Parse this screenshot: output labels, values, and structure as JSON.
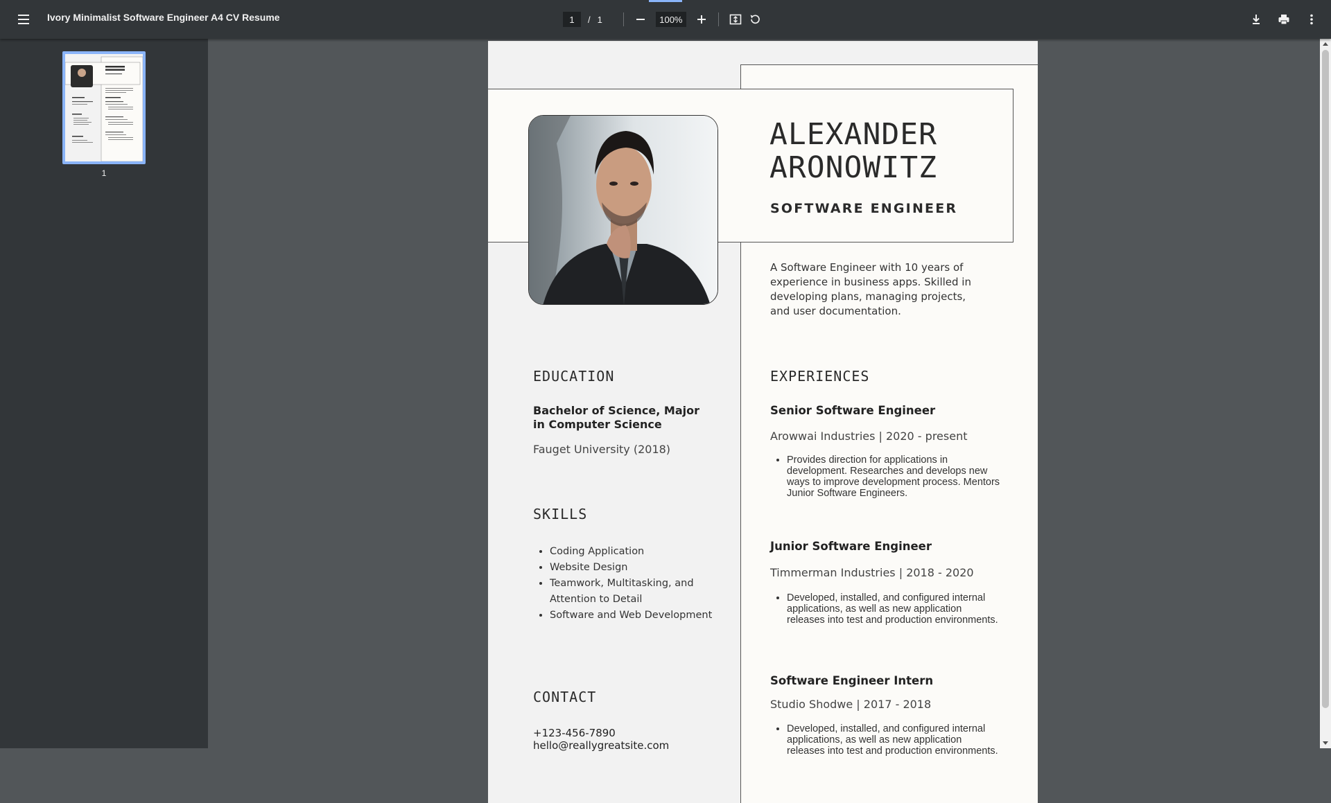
{
  "toolbar": {
    "doc_title": "Ivory Minimalist Software Engineer A4 CV Resume",
    "page_current": "1",
    "page_separator": "/",
    "page_total": "1",
    "zoom": "100%",
    "icons": [
      "menu-icon",
      "zoom-out-icon",
      "zoom-in-icon",
      "fit-page-icon",
      "rotate-icon",
      "download-icon",
      "print-icon",
      "more-options-icon"
    ]
  },
  "sidebar": {
    "thumbnails": [
      {
        "label": "1"
      }
    ]
  },
  "resume": {
    "name_line1": "ALEXANDER",
    "name_line2": "ARONOWITZ",
    "role": "SOFTWARE ENGINEER",
    "summary": "A Software Engineer with 10 years of experience in business apps. Skilled in developing plans, managing projects, and user documentation.",
    "education": {
      "heading": "EDUCATION",
      "degree": "Bachelor of Science, Major in Computer Science",
      "school": "Fauget University (2018)"
    },
    "skills": {
      "heading": "SKILLS",
      "items": [
        "Coding Application",
        "Website Design",
        " Teamwork, Multitasking, and Attention to Detail",
        " Software and Web Development"
      ]
    },
    "contact": {
      "heading": "CONTACT",
      "phone": "+123-456-7890",
      "email": "hello@reallygreatsite.com"
    },
    "experiences": {
      "heading": "EXPERIENCES",
      "jobs": [
        {
          "title": "Senior Software Engineer",
          "company": "Arowwai Industries | 2020 - present",
          "bullet": "Provides direction for applications in development. Researches and develops new ways to improve development process. Mentors Junior Software Engineers."
        },
        {
          "title": "Junior Software Engineer",
          "company": "Timmerman Industries | 2018 - 2020",
          "bullet": "Developed, installed, and configured internal applications, as well as new application releases into test and production environments."
        },
        {
          "title": "Software Engineer Intern",
          "company": "Studio Shodwe | 2017 - 2018",
          "bullet": "Developed, installed, and configured internal applications, as well as new application releases into test and production environments."
        }
      ]
    }
  }
}
